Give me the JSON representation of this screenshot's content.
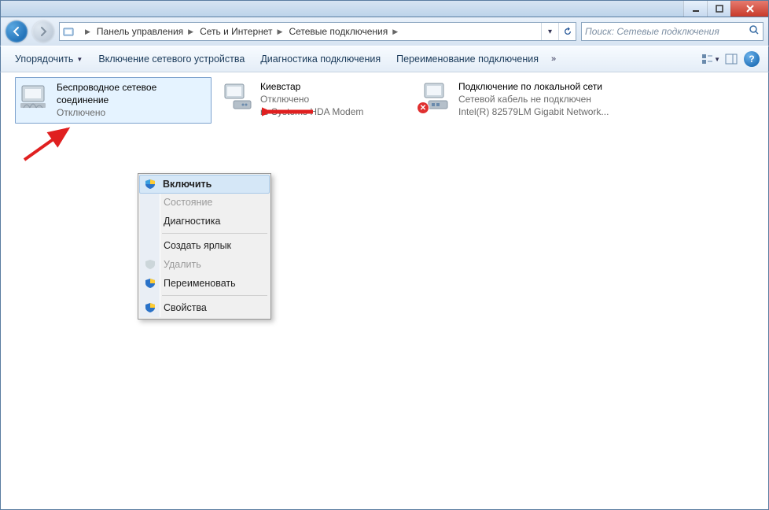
{
  "breadcrumbs": {
    "a": "Панель управления",
    "b": "Сеть и Интернет",
    "c": "Сетевые подключения"
  },
  "search": {
    "placeholder": "Поиск: Сетевые подключения"
  },
  "toolbar": {
    "organize": "Упорядочить",
    "enable": "Включение сетевого устройства",
    "diagnose": "Диагностика подключения",
    "rename": "Переименование подключения",
    "overflow": "»"
  },
  "connections": {
    "wifi": {
      "name": "Беспроводное сетевое соединение",
      "status": "Отключено"
    },
    "modem": {
      "name": "Киевстар",
      "status": "Отключено",
      "device": "re Systems HDA Modem"
    },
    "lan": {
      "name": "Подключение по локальной сети",
      "status": "Сетевой кабель не подключен",
      "device": "Intel(R) 82579LM Gigabit Network..."
    }
  },
  "context_menu": {
    "enable": "Включить",
    "status": "Состояние",
    "diagnose": "Диагностика",
    "shortcut": "Создать ярлык",
    "delete": "Удалить",
    "rename": "Переименовать",
    "properties": "Свойства"
  }
}
